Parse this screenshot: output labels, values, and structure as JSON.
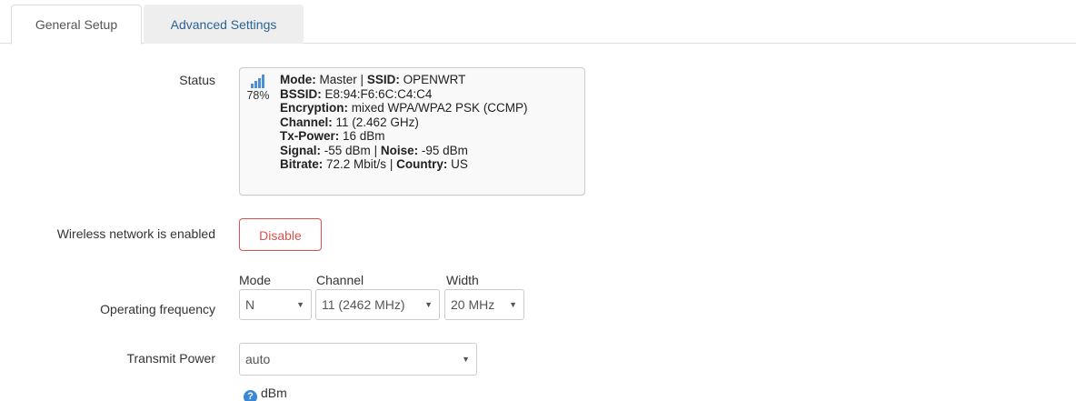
{
  "tabs": [
    {
      "label": "General Setup",
      "active": true
    },
    {
      "label": "Advanced Settings",
      "active": false
    }
  ],
  "status": {
    "label": "Status",
    "signal_percent": "78%",
    "signal_icon": "signal-strength-icon",
    "mode_key": "Mode:",
    "mode_value": "Master",
    "ssid_key": "SSID:",
    "ssid_value": "OPENWRT",
    "bssid_key": "BSSID:",
    "bssid_value": "E8:94:F6:6C:C4:C4",
    "encryption_key": "Encryption:",
    "encryption_value": "mixed WPA/WPA2 PSK (CCMP)",
    "channel_key": "Channel:",
    "channel_value": "11 (2.462 GHz)",
    "txpower_key": "Tx-Power:",
    "txpower_value": "16 dBm",
    "signal_key": "Signal:",
    "signal_value": "-55 dBm",
    "noise_key": "Noise:",
    "noise_value": "-95 dBm",
    "bitrate_key": "Bitrate:",
    "bitrate_value": "72.2 Mbit/s",
    "country_key": "Country:",
    "country_value": "US",
    "separator": "|"
  },
  "wireless": {
    "label": "Wireless network is enabled",
    "button_label": "Disable"
  },
  "frequency": {
    "label": "Operating frequency",
    "mode_header": "Mode",
    "channel_header": "Channel",
    "width_header": "Width",
    "mode_value": "N",
    "channel_value": "11 (2462 MHz)",
    "width_value": "20 MHz"
  },
  "txpower": {
    "label": "Transmit Power",
    "value": "auto",
    "help_text": "dBm"
  },
  "colors": {
    "accent_link": "#2a6496",
    "danger": "#d9534f",
    "border": "#cccccc",
    "help_icon": "#3a87d6"
  }
}
